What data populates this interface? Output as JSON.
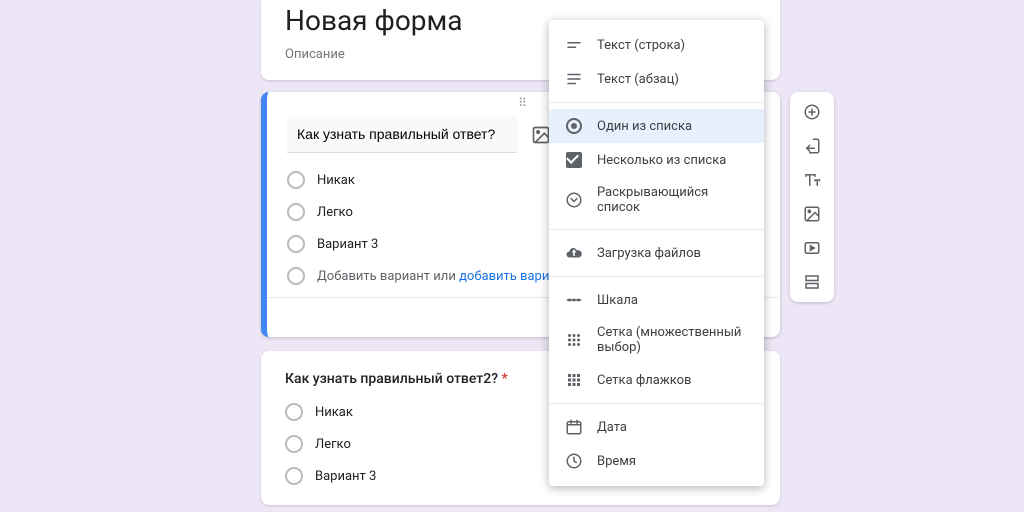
{
  "header": {
    "title": "Новая форма",
    "description": "Описание"
  },
  "active_question": {
    "title": "Как узнать правильный ответ?",
    "options": [
      "Никак",
      "Легко",
      "Вариант 3"
    ],
    "add_option_text": "Добавить вариант",
    "or_text": "или",
    "add_other_link": "добавить вариант \"Другое\""
  },
  "second_question": {
    "title": "Как узнать правильный ответ2?",
    "required": true,
    "options": [
      "Никак",
      "Легко",
      "Вариант 3"
    ]
  },
  "type_menu": {
    "items": [
      {
        "id": "short",
        "icon": "short-text",
        "label": "Текст (строка)"
      },
      {
        "id": "paragraph",
        "icon": "paragraph",
        "label": "Текст (абзац)"
      },
      {
        "id": "radio",
        "icon": "radio",
        "label": "Один из списка",
        "selected": true
      },
      {
        "id": "checkbox",
        "icon": "checkbox",
        "label": "Несколько из списка"
      },
      {
        "id": "dropdown",
        "icon": "dropdown",
        "label": "Раскрывающийся список"
      },
      {
        "id": "upload",
        "icon": "upload",
        "label": "Загрузка файлов"
      },
      {
        "id": "scale",
        "icon": "scale",
        "label": "Шкала"
      },
      {
        "id": "mgrid",
        "icon": "grid-radio",
        "label": "Сетка (множественный выбор)"
      },
      {
        "id": "cgrid",
        "icon": "grid-check",
        "label": "Сетка флажков"
      },
      {
        "id": "date",
        "icon": "date",
        "label": "Дата"
      },
      {
        "id": "time",
        "icon": "time",
        "label": "Время"
      }
    ],
    "separators_after": [
      "paragraph",
      "dropdown",
      "upload",
      "cgrid"
    ]
  },
  "side_toolbar": [
    {
      "id": "add-question",
      "icon": "plus-circle"
    },
    {
      "id": "import",
      "icon": "import"
    },
    {
      "id": "add-title",
      "icon": "text"
    },
    {
      "id": "add-image",
      "icon": "image"
    },
    {
      "id": "add-video",
      "icon": "video"
    },
    {
      "id": "add-section",
      "icon": "section"
    }
  ]
}
